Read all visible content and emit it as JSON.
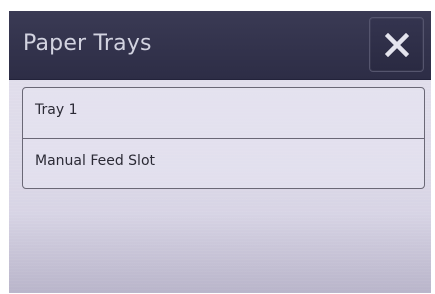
{
  "header": {
    "title": "Paper Trays",
    "close_icon": "close-icon"
  },
  "trays": {
    "items": [
      {
        "label": "Tray 1"
      },
      {
        "label": "Manual Feed Slot"
      }
    ]
  },
  "colors": {
    "title_bar": "#2d2d46",
    "title_text": "#d2d3e0",
    "screen_background": "#dcd9e8"
  }
}
